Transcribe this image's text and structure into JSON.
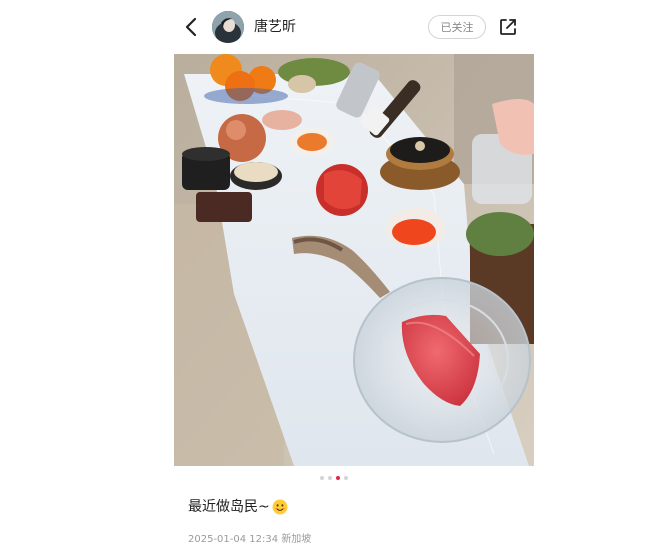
{
  "header": {
    "username": "唐艺昕",
    "follow_label": "已关注"
  },
  "icons": {
    "back": "chevron-left-icon",
    "share": "share-external-icon",
    "emoji": "smiling-face-emoji"
  },
  "pagination": {
    "total": 4,
    "active_index": 2
  },
  "post": {
    "caption": "最近做岛民~",
    "timestamp": "2025-01-04 12:34",
    "location": "新加坡"
  },
  "colors": {
    "active_dot": "#e0284a",
    "inactive_dot": "#d4d4d4"
  }
}
